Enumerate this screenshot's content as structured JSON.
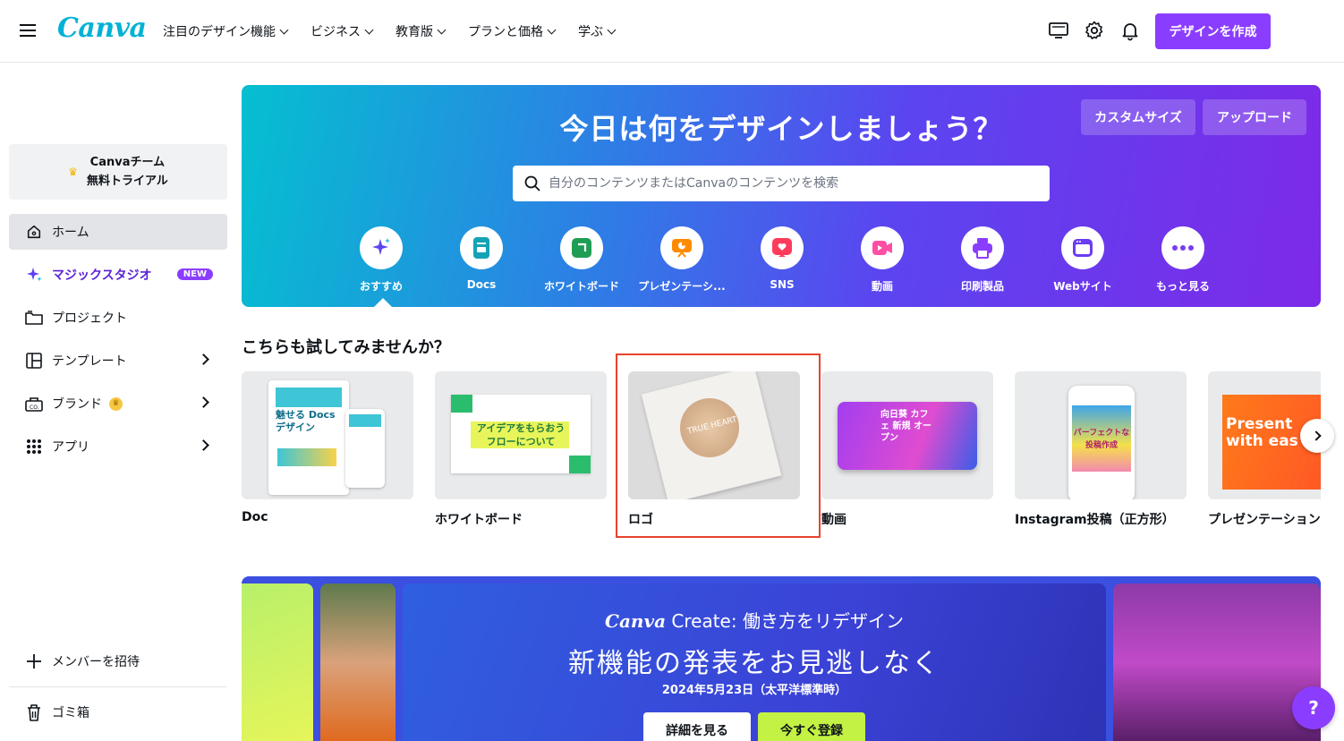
{
  "header": {
    "logo": "Canva",
    "nav": [
      {
        "label": "注目のデザイン機能"
      },
      {
        "label": "ビジネス"
      },
      {
        "label": "教育版"
      },
      {
        "label": "プランと価格"
      },
      {
        "label": "学ぶ"
      }
    ],
    "icons": [
      "monitor-icon",
      "gear-icon",
      "bell-icon"
    ],
    "create_button": "デザインを作成"
  },
  "sidebar": {
    "trial_line1": "Canvaチーム",
    "trial_line2": "無料トライアル",
    "items": [
      {
        "label": "ホーム",
        "icon": "home-icon",
        "active": true
      },
      {
        "label": "マジックスタジオ",
        "icon": "sparkle-icon",
        "badge": "NEW"
      },
      {
        "label": "プロジェクト",
        "icon": "folder-icon"
      },
      {
        "label": "テンプレート",
        "icon": "template-icon",
        "arrow": true
      },
      {
        "label": "ブランド",
        "icon": "brand-icon",
        "arrow": true
      },
      {
        "label": "アプリ",
        "icon": "apps-grid-icon",
        "arrow": true
      }
    ],
    "invite": "メンバーを招待",
    "trash": "ゴミ箱"
  },
  "hero": {
    "title": "今日は何をデザインしましょう？",
    "custom_size": "カスタムサイズ",
    "upload": "アップロード",
    "search_placeholder": "自分のコンテンツまたはCanvaのコンテンツを検索",
    "categories": [
      {
        "label": "おすすめ",
        "icon": "sparkle-icon",
        "color": "#5b45f0"
      },
      {
        "label": "Docs",
        "icon": "doc-icon",
        "color": "#13a3b5"
      },
      {
        "label": "ホワイトボード",
        "icon": "whiteboard-icon",
        "color": "#1f9d55"
      },
      {
        "label": "プレゼンテーシ...",
        "icon": "presentation-icon",
        "color": "#ff8a00"
      },
      {
        "label": "SNS",
        "icon": "heart-icon",
        "color": "#ff3b5c"
      },
      {
        "label": "動画",
        "icon": "video-icon",
        "color": "#ff4fa3"
      },
      {
        "label": "印刷製品",
        "icon": "printer-icon",
        "color": "#8b3dff"
      },
      {
        "label": "Webサイト",
        "icon": "website-icon",
        "color": "#6b3cf0"
      },
      {
        "label": "もっと見る",
        "icon": "more-icon",
        "color": "#7a3cf0"
      }
    ]
  },
  "suggestions": {
    "title": "こちらも試してみませんか？",
    "cards": [
      {
        "label": "Doc",
        "thumb_text": "魅せる Docsデザイン"
      },
      {
        "label": "ホワイトボード",
        "thumb_text": "アイデアをもらおう フローについて"
      },
      {
        "label": "ロゴ",
        "thumb_text": "TRUE HEART"
      },
      {
        "label": "動画",
        "thumb_text": "向日葵 カフェ 新規 オープン"
      },
      {
        "label": "Instagram投稿（正方形）",
        "thumb_text": "パーフェクトな 投稿作成"
      },
      {
        "label": "プレゼンテーション",
        "thumb_text": "Present with eas"
      }
    ]
  },
  "banner": {
    "brand": "Canva",
    "brand_rest": "Create: 働き方をリデザイン",
    "headline": "新機能の発表をお見逃しなく",
    "date": "2024年5月23日（太平洋標準時）",
    "details_button": "詳細を見る",
    "register_button": "今すぐ登録"
  },
  "help": "?"
}
